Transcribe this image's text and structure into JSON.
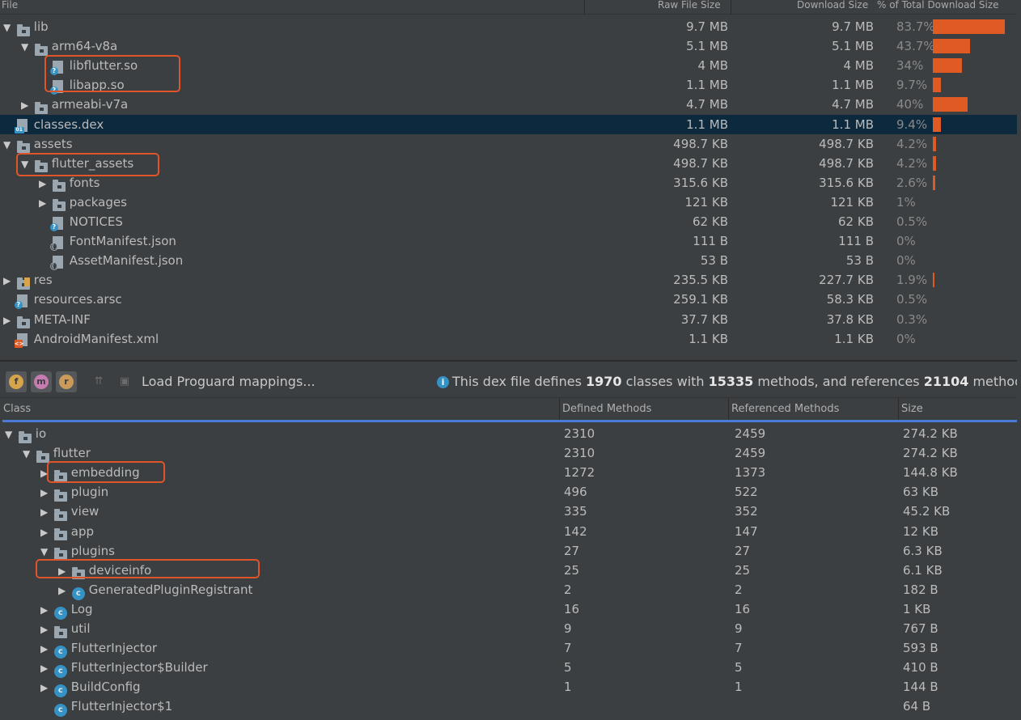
{
  "top_table": {
    "headers": {
      "file": "File",
      "raw": "Raw File Size",
      "download": "Download Size",
      "percent": "% of Total Download Size"
    },
    "rows": [
      {
        "name": "lib",
        "arrow": "▼",
        "icon": "folder",
        "raw": "9.7 MB",
        "dl": "9.7 MB",
        "pct": "83.7%",
        "bar": 0.837
      },
      {
        "name": "arm64-v8a",
        "arrow": "▼",
        "icon": "folder",
        "raw": "5.1 MB",
        "dl": "5.1 MB",
        "pct": "43.7%",
        "bar": 0.437
      },
      {
        "name": "libflutter.so",
        "arrow": "",
        "icon": "file-unknown",
        "raw": "4 MB",
        "dl": "4 MB",
        "pct": "34%",
        "bar": 0.34
      },
      {
        "name": "libapp.so",
        "arrow": "",
        "icon": "file-unknown",
        "raw": "1.1 MB",
        "dl": "1.1 MB",
        "pct": "9.7%",
        "bar": 0.097
      },
      {
        "name": "armeabi-v7a",
        "arrow": "▶",
        "icon": "folder",
        "raw": "4.7 MB",
        "dl": "4.7 MB",
        "pct": "40%",
        "bar": 0.4
      },
      {
        "name": "classes.dex",
        "arrow": "",
        "icon": "file-dex",
        "raw": "1.1 MB",
        "dl": "1.1 MB",
        "pct": "9.4%",
        "bar": 0.094,
        "selected": true
      },
      {
        "name": "assets",
        "arrow": "▼",
        "icon": "folder",
        "raw": "498.7 KB",
        "dl": "498.7 KB",
        "pct": "4.2%",
        "bar": 0.042
      },
      {
        "name": "flutter_assets",
        "arrow": "▼",
        "icon": "folder",
        "raw": "498.7 KB",
        "dl": "498.7 KB",
        "pct": "4.2%",
        "bar": 0.042
      },
      {
        "name": "fonts",
        "arrow": "▶",
        "icon": "folder",
        "raw": "315.6 KB",
        "dl": "315.6 KB",
        "pct": "2.6%",
        "bar": 0.026
      },
      {
        "name": "packages",
        "arrow": "▶",
        "icon": "folder",
        "raw": "121 KB",
        "dl": "121 KB",
        "pct": "1%",
        "bar": 0.0
      },
      {
        "name": "NOTICES",
        "arrow": "",
        "icon": "file-unknown",
        "raw": "62 KB",
        "dl": "62 KB",
        "pct": "0.5%",
        "bar": 0.0
      },
      {
        "name": "FontManifest.json",
        "arrow": "",
        "icon": "file-json",
        "raw": "111 B",
        "dl": "111 B",
        "pct": "0%",
        "bar": 0.0
      },
      {
        "name": "AssetManifest.json",
        "arrow": "",
        "icon": "file-json",
        "raw": "53 B",
        "dl": "53 B",
        "pct": "0%",
        "bar": 0.0
      },
      {
        "name": "res",
        "arrow": "▶",
        "icon": "folder-res",
        "raw": "235.5 KB",
        "dl": "227.7 KB",
        "pct": "1.9%",
        "bar": 0.019
      },
      {
        "name": "resources.arsc",
        "arrow": "",
        "icon": "file-unknown",
        "raw": "259.1 KB",
        "dl": "58.3 KB",
        "pct": "0.5%",
        "bar": 0.0
      },
      {
        "name": "META-INF",
        "arrow": "▶",
        "icon": "folder",
        "raw": "37.7 KB",
        "dl": "37.8 KB",
        "pct": "0.3%",
        "bar": 0.0
      },
      {
        "name": "AndroidManifest.xml",
        "arrow": "",
        "icon": "file-xml",
        "raw": "1.1 KB",
        "dl": "1.1 KB",
        "pct": "0%",
        "bar": 0.0
      }
    ]
  },
  "toolbar": {
    "load_proguard": "Load Proguard mappings...",
    "info_pre": "This dex file defines ",
    "info_classes": "1970",
    "info_mid1": " classes with ",
    "info_methods": "15335",
    "info_mid2": " methods, and references ",
    "info_refs": "21104",
    "info_post": " methods"
  },
  "class_table": {
    "headers": {
      "class": "Class",
      "defined": "Defined Methods",
      "referenced": "Referenced Methods",
      "size": "Size"
    },
    "rows": [
      {
        "name": "io",
        "arrow": "▼",
        "icon": "package",
        "def": "2310",
        "ref": "2459",
        "size": "274.2 KB"
      },
      {
        "name": "flutter",
        "arrow": "▼",
        "icon": "package",
        "def": "2310",
        "ref": "2459",
        "size": "274.2 KB"
      },
      {
        "name": "embedding",
        "arrow": "▶",
        "icon": "package",
        "def": "1272",
        "ref": "1373",
        "size": "144.8 KB"
      },
      {
        "name": "plugin",
        "arrow": "▶",
        "icon": "package",
        "def": "496",
        "ref": "522",
        "size": "63 KB"
      },
      {
        "name": "view",
        "arrow": "▶",
        "icon": "package",
        "def": "335",
        "ref": "352",
        "size": "45.2 KB"
      },
      {
        "name": "app",
        "arrow": "▶",
        "icon": "package",
        "def": "142",
        "ref": "147",
        "size": "12 KB"
      },
      {
        "name": "plugins",
        "arrow": "▼",
        "icon": "package",
        "def": "27",
        "ref": "27",
        "size": "6.3 KB"
      },
      {
        "name": "deviceinfo",
        "arrow": "▶",
        "icon": "package",
        "def": "25",
        "ref": "25",
        "size": "6.1 KB"
      },
      {
        "name": "GeneratedPluginRegistrant",
        "arrow": "▶",
        "icon": "class",
        "def": "2",
        "ref": "2",
        "size": "182 B"
      },
      {
        "name": "Log",
        "arrow": "▶",
        "icon": "class",
        "def": "16",
        "ref": "16",
        "size": "1 KB"
      },
      {
        "name": "util",
        "arrow": "▶",
        "icon": "package",
        "def": "9",
        "ref": "9",
        "size": "767 B"
      },
      {
        "name": "FlutterInjector",
        "arrow": "▶",
        "icon": "class",
        "def": "7",
        "ref": "7",
        "size": "593 B"
      },
      {
        "name": "FlutterInjector$Builder",
        "arrow": "▶",
        "icon": "class",
        "def": "5",
        "ref": "5",
        "size": "410 B"
      },
      {
        "name": "BuildConfig",
        "arrow": "▶",
        "icon": "class",
        "def": "1",
        "ref": "1",
        "size": "144 B"
      },
      {
        "name": "FlutterInjector$1",
        "arrow": "",
        "icon": "class",
        "def": "",
        "ref": "",
        "size": "64 B"
      }
    ]
  },
  "colors": {
    "bar": "#e05a24",
    "selection": "#0d293e",
    "accent_line": "#4a7cd5",
    "highlight_box": "#e0542a"
  }
}
